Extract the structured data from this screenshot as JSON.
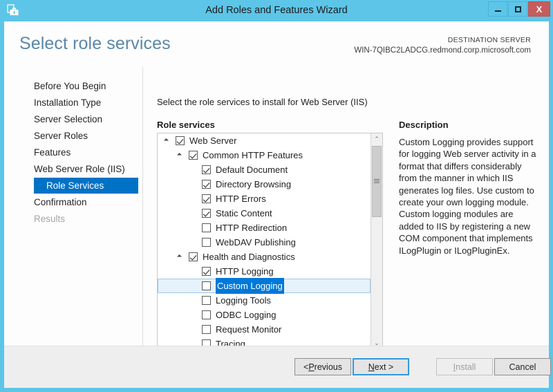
{
  "window": {
    "title": "Add Roles and Features Wizard",
    "icon": "wizard-toolbox-icon",
    "minimize_label": "",
    "maximize_label": "",
    "close_label": "X",
    "frame_color": "#5dc5e8"
  },
  "header": {
    "page_title": "Select role services",
    "destination_label": "DESTINATION SERVER",
    "destination_server": "WIN-7QIBC2LADCG.redmond.corp.microsoft.com",
    "title_color": "#5b87a8"
  },
  "sidebar": {
    "selected_index": 6,
    "accent_color": "#0072c6",
    "items": [
      {
        "label": "Before You Begin",
        "state": "normal"
      },
      {
        "label": "Installation Type",
        "state": "normal"
      },
      {
        "label": "Server Selection",
        "state": "normal"
      },
      {
        "label": "Server Roles",
        "state": "normal"
      },
      {
        "label": "Features",
        "state": "normal"
      },
      {
        "label": "Web Server Role (IIS)",
        "state": "normal"
      },
      {
        "label": "Role Services",
        "state": "selected"
      },
      {
        "label": "Confirmation",
        "state": "normal"
      },
      {
        "label": "Results",
        "state": "disabled"
      }
    ]
  },
  "main": {
    "instruction": "Select the role services to install for Web Server (IIS)",
    "role_services_label": "Role services",
    "description_label": "Description",
    "description_body": "Custom Logging provides support for logging Web server activity in a format that differs considerably from the manner in which IIS generates log files. Use custom to create your own logging module. Custom logging modules are added to IIS by registering a new COM component that implements ILogPlugin or ILogPluginEx.",
    "selection_row_color": "#e6f2fb",
    "selection_text_color": "#0078d7"
  },
  "tree": {
    "selected_item": "Custom Logging",
    "rows": [
      {
        "label": "Web Server",
        "level": 0,
        "checked": true,
        "expander": "open",
        "selected": false
      },
      {
        "label": "Common HTTP Features",
        "level": 1,
        "checked": true,
        "expander": "open",
        "selected": false
      },
      {
        "label": "Default Document",
        "level": 2,
        "checked": true,
        "expander": "none",
        "selected": false
      },
      {
        "label": "Directory Browsing",
        "level": 2,
        "checked": true,
        "expander": "none",
        "selected": false
      },
      {
        "label": "HTTP Errors",
        "level": 2,
        "checked": true,
        "expander": "none",
        "selected": false
      },
      {
        "label": "Static Content",
        "level": 2,
        "checked": true,
        "expander": "none",
        "selected": false
      },
      {
        "label": "HTTP Redirection",
        "level": 2,
        "checked": false,
        "expander": "none",
        "selected": false
      },
      {
        "label": "WebDAV Publishing",
        "level": 2,
        "checked": false,
        "expander": "none",
        "selected": false
      },
      {
        "label": "Health and Diagnostics",
        "level": 1,
        "checked": true,
        "expander": "open",
        "selected": false
      },
      {
        "label": "HTTP Logging",
        "level": 2,
        "checked": true,
        "expander": "none",
        "selected": false
      },
      {
        "label": "Custom Logging",
        "level": 2,
        "checked": false,
        "expander": "none",
        "selected": true
      },
      {
        "label": "Logging Tools",
        "level": 2,
        "checked": false,
        "expander": "none",
        "selected": false
      },
      {
        "label": "ODBC Logging",
        "level": 2,
        "checked": false,
        "expander": "none",
        "selected": false
      },
      {
        "label": "Request Monitor",
        "level": 2,
        "checked": false,
        "expander": "none",
        "selected": false
      },
      {
        "label": "Tracing",
        "level": 2,
        "checked": false,
        "expander": "none",
        "selected": false
      }
    ]
  },
  "scrollbars": {
    "vertical": {
      "up_glyph": "⌃",
      "down_glyph": "⌄"
    },
    "horizontal": {
      "left_glyph": "‹",
      "right_glyph": "›"
    }
  },
  "footer": {
    "previous": {
      "pre": "< ",
      "accel": "P",
      "post": "revious",
      "state": "normal"
    },
    "next": {
      "pre": "",
      "accel": "N",
      "post": "ext >",
      "state": "focused"
    },
    "install": {
      "pre": "",
      "accel": "I",
      "post": "nstall",
      "state": "disabled"
    },
    "cancel": {
      "pre": "",
      "accel": "",
      "post": "Cancel",
      "state": "normal"
    }
  }
}
